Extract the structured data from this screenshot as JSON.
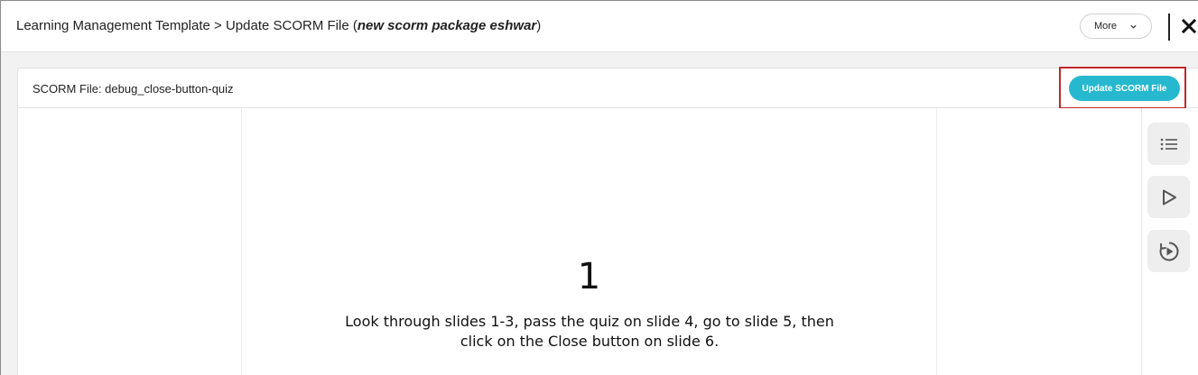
{
  "header": {
    "breadcrumb_prefix": "Learning Management Template > Update SCORM File (",
    "breadcrumb_package": "new scorm package eshwar",
    "breadcrumb_suffix": ")",
    "more_label": "More"
  },
  "panel": {
    "scorm_file_label": "SCORM File: debug_close-button-quiz",
    "update_button_label": "Update SCORM File"
  },
  "slide": {
    "number": "1",
    "text": "Look through slides 1-3, pass the quiz on slide 4, go to slide 5, then click on the Close button on slide 6."
  },
  "side_rail": {
    "icons": [
      "list-icon",
      "play-icon",
      "replay-icon"
    ]
  },
  "colors": {
    "accent": "#26b8cf",
    "highlight_border": "#c0282d"
  }
}
